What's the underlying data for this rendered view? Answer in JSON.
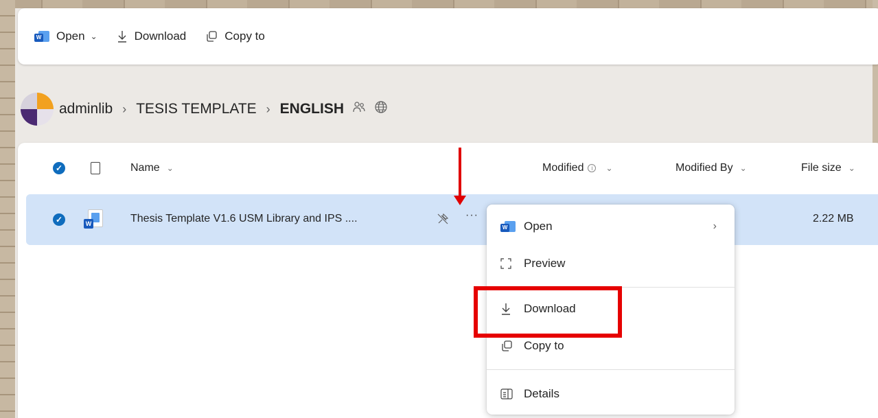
{
  "commandbar": {
    "open_label": "Open",
    "download_label": "Download",
    "copy_to_label": "Copy to"
  },
  "breadcrumb": {
    "site": "adminlib",
    "folder": "TESIS TEMPLATE",
    "current": "ENGLISH"
  },
  "columns": {
    "name": "Name",
    "modified": "Modified",
    "modified_by": "Modified By",
    "file_size": "File size"
  },
  "file": {
    "name": "Thesis Template V1.6 USM Library and IPS ....",
    "size": "2.22 MB"
  },
  "context_menu": {
    "items": [
      {
        "label": "Open",
        "icon": "word-icon",
        "has_submenu": true
      },
      {
        "label": "Preview",
        "icon": "preview-icon"
      },
      {
        "label": "Download",
        "icon": "download-icon"
      },
      {
        "label": "Copy to",
        "icon": "copy-icon"
      },
      {
        "label": "Details",
        "icon": "details-icon"
      }
    ]
  },
  "colors": {
    "accent": "#0f6cbd",
    "selected_row": "#d2e3f8",
    "annotation": "#e60000"
  }
}
